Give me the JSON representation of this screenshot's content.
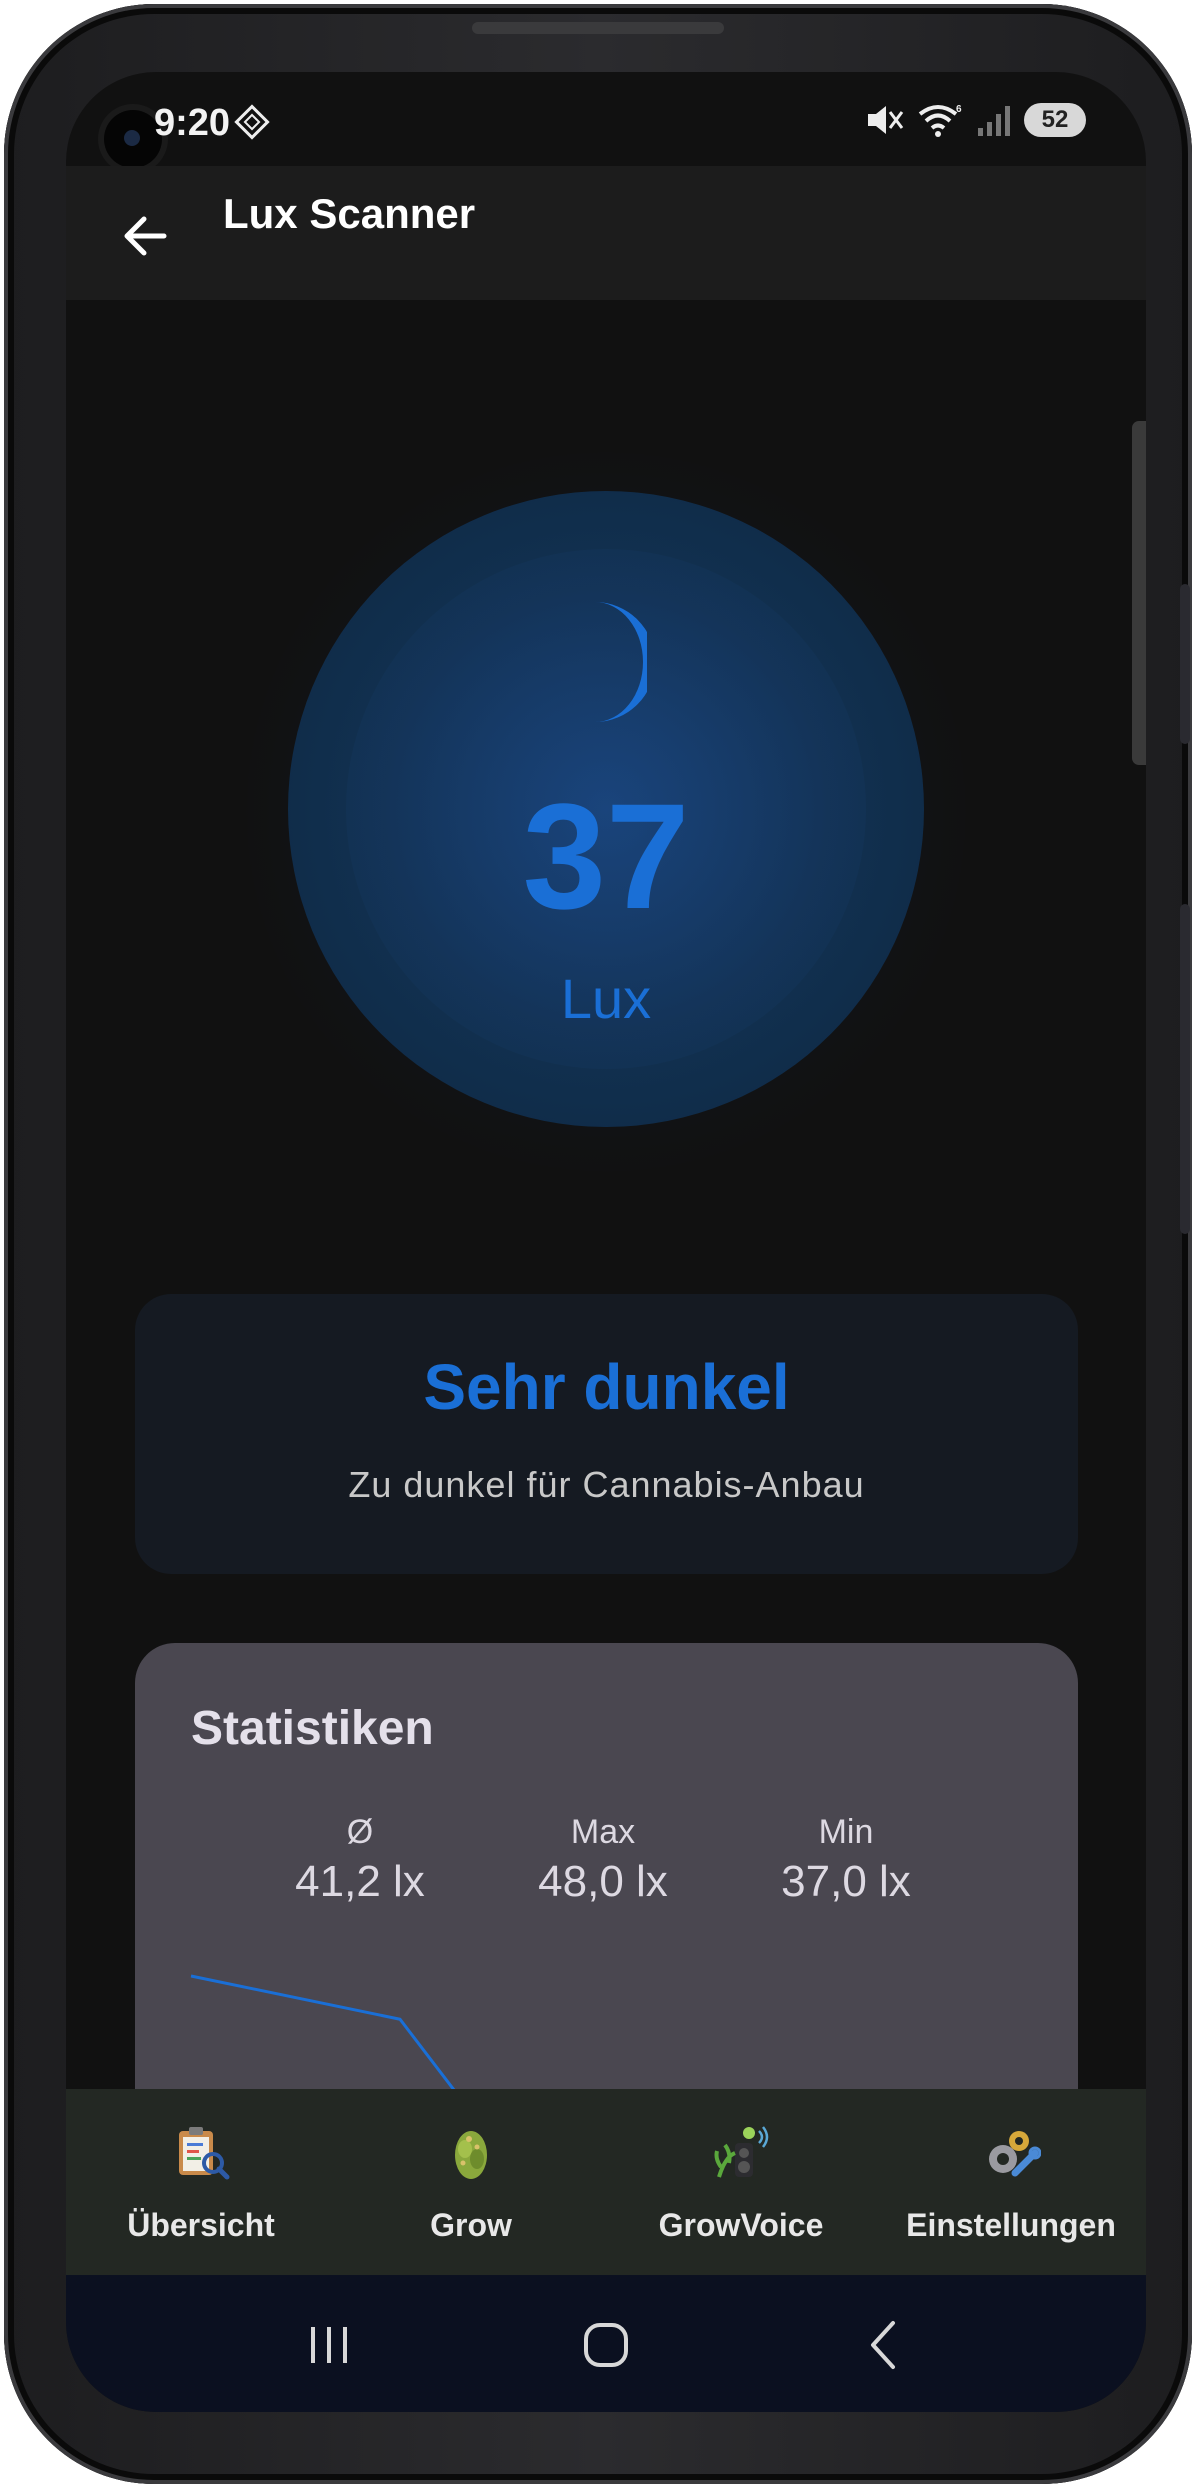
{
  "status_bar": {
    "time": "9:20",
    "battery": "52"
  },
  "app_bar": {
    "title": "Lux Scanner"
  },
  "reading": {
    "value": "37",
    "unit": "Lux",
    "icon": "moon-icon"
  },
  "status": {
    "title": "Sehr dunkel",
    "description": "Zu dunkel für Cannabis-Anbau"
  },
  "stats": {
    "title": "Statistiken",
    "items": [
      {
        "label": "Ø",
        "value": "41,2 lx"
      },
      {
        "label": "Max",
        "value": "48,0 lx"
      },
      {
        "label": "Min",
        "value": "37,0 lx"
      }
    ]
  },
  "chart_data": {
    "type": "line",
    "series": [
      {
        "values": [
          48.0,
          46.5,
          37.0
        ]
      }
    ],
    "line_color": "#1a6fd6",
    "grid": false
  },
  "bottom_nav": {
    "items": [
      {
        "label": "Übersicht",
        "icon": "clipboard-magnifier-icon"
      },
      {
        "label": "Grow",
        "icon": "cannabis-bud-icon"
      },
      {
        "label": "GrowVoice",
        "icon": "grow-plant-speaker-icon"
      },
      {
        "label": "Einstellungen",
        "icon": "gears-wrench-icon"
      }
    ]
  },
  "colors": {
    "accent": "#1a6fd6",
    "background": "#111111",
    "card": "#151a22",
    "stats_card": "#4a4750",
    "nav_bar": "#232823"
  }
}
